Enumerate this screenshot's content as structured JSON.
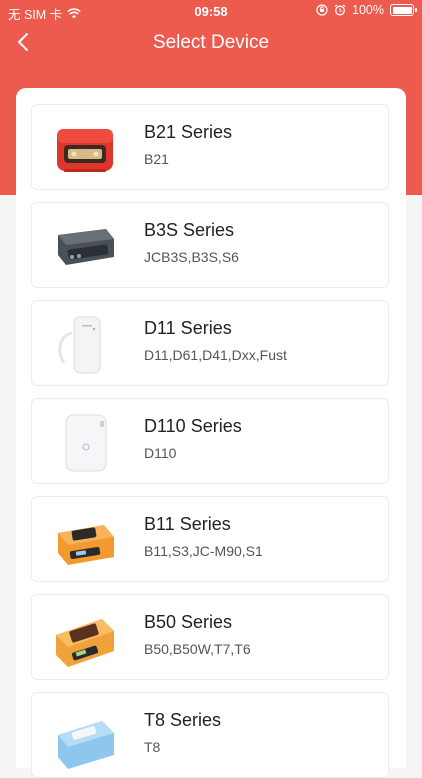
{
  "status": {
    "carrier": "无 SIM 卡",
    "time": "09:58",
    "battery": "100%"
  },
  "header": {
    "title": "Select Device"
  },
  "devices": [
    {
      "series": "B21 Series",
      "models": "B21",
      "color": "#e0352a",
      "kind": "boxy"
    },
    {
      "series": "B3S Series",
      "models": "JCB3S,B3S,S6",
      "color": "#444a52",
      "kind": "dark"
    },
    {
      "series": "D11 Series",
      "models": "D11,D61,D41,Dxx,Fust",
      "color": "#f2f2f2",
      "kind": "tall"
    },
    {
      "series": "D110 Series",
      "models": "D110",
      "color": "#f4f4f6",
      "kind": "cube"
    },
    {
      "series": "B11 Series",
      "models": "B11,S3,JC-M90,S1",
      "color": "#f29a2e",
      "kind": "orange"
    },
    {
      "series": "B50 Series",
      "models": "B50,B50W,T7,T6",
      "color": "#f0a23a",
      "kind": "orange2"
    },
    {
      "series": "T8 Series",
      "models": "T8",
      "color": "#8ec6ee",
      "kind": "blue"
    }
  ]
}
